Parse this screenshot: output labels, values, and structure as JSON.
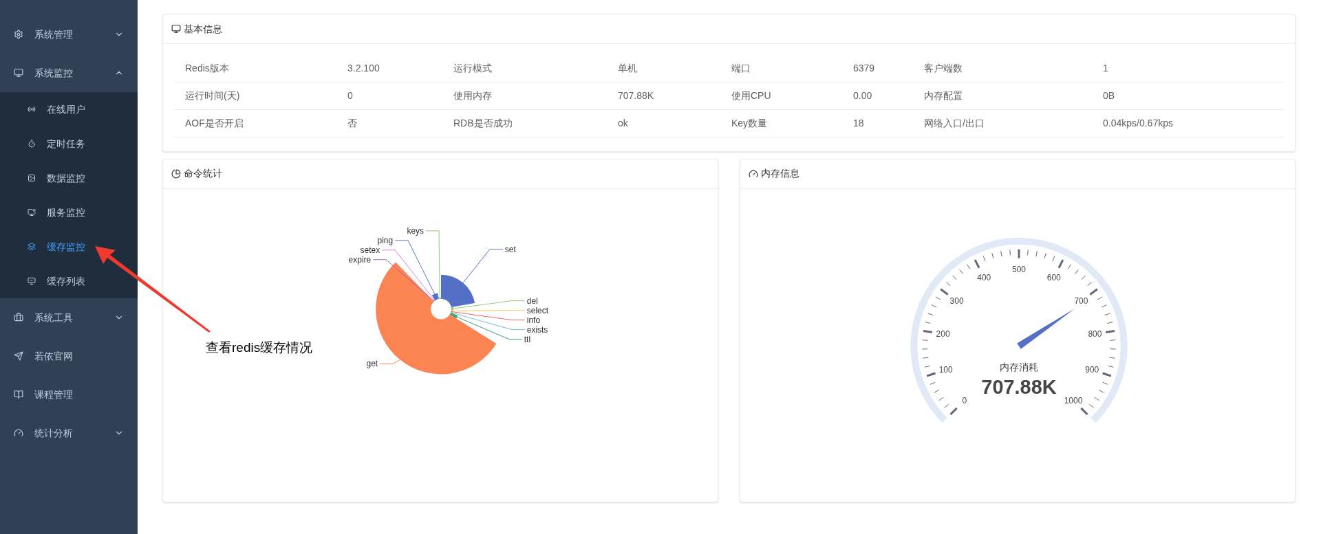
{
  "sidebar": {
    "items": [
      {
        "label": "系统管理",
        "kind": "group",
        "expanded": false
      },
      {
        "label": "系统监控",
        "kind": "group",
        "expanded": true,
        "children": [
          {
            "label": "在线用户",
            "selected": false
          },
          {
            "label": "定时任务",
            "selected": false
          },
          {
            "label": "数据监控",
            "selected": false
          },
          {
            "label": "服务监控",
            "selected": false
          },
          {
            "label": "缓存监控",
            "selected": true
          },
          {
            "label": "缓存列表",
            "selected": false
          }
        ]
      },
      {
        "label": "系统工具",
        "kind": "group",
        "expanded": false
      },
      {
        "label": "若依官网",
        "kind": "link"
      },
      {
        "label": "课程管理",
        "kind": "link"
      },
      {
        "label": "统计分析",
        "kind": "group",
        "expanded": false
      }
    ]
  },
  "basic_info": {
    "title": "基本信息",
    "rows": [
      [
        "Redis版本",
        "3.2.100",
        "运行模式",
        "单机",
        "端口",
        "6379",
        "客户端数",
        "1"
      ],
      [
        "运行时间(天)",
        "0",
        "使用内存",
        "707.88K",
        "使用CPU",
        "0.00",
        "内存配置",
        "0B"
      ],
      [
        "AOF是否开启",
        "否",
        "RDB是否成功",
        "ok",
        "Key数量",
        "18",
        "网络入口/出口",
        "0.04kps/0.67kps"
      ]
    ]
  },
  "command_stats": {
    "title": "命令统计",
    "slices": [
      {
        "label": "set"
      },
      {
        "label": "del"
      },
      {
        "label": "select"
      },
      {
        "label": "info"
      },
      {
        "label": "exists"
      },
      {
        "label": "ttl"
      },
      {
        "label": "get"
      },
      {
        "label": "expire"
      },
      {
        "label": "setex"
      },
      {
        "label": "ping"
      },
      {
        "label": "keys"
      }
    ]
  },
  "memory_info": {
    "title": "内存信息",
    "gauge": {
      "name": "内存消耗",
      "value": "707.88K",
      "level": 0.708,
      "ticks": [
        "0",
        "100",
        "200",
        "300",
        "400",
        "500",
        "600",
        "700",
        "800",
        "900",
        "1000"
      ]
    }
  },
  "annotation": {
    "text": "查看redis缓存情况"
  }
}
